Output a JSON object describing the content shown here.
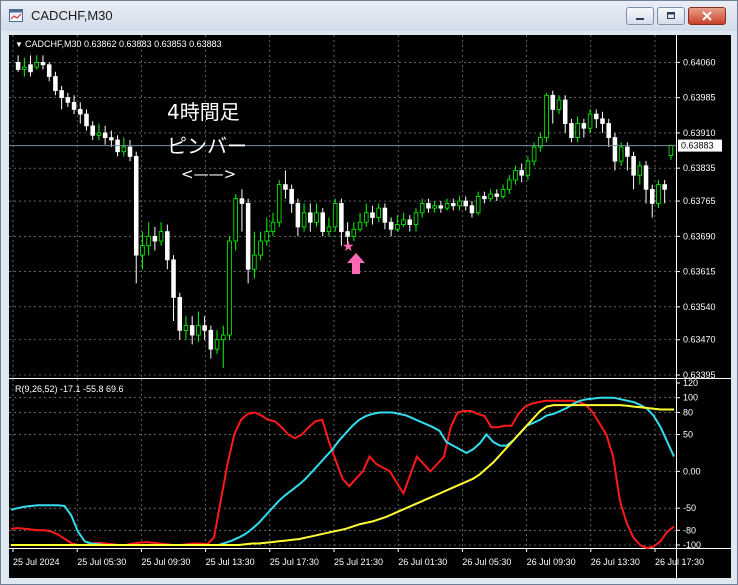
{
  "window": {
    "title": "CADCHF,M30",
    "buttons": [
      "minimize",
      "maximize",
      "close"
    ]
  },
  "price_pane": {
    "header_arrow": "▼",
    "header": "CADCHF,M30  0.63862 0.63883 0.63853 0.63883",
    "current_price": "0.63883",
    "y_ticks": [
      "0.64060",
      "0.63985",
      "0.63910",
      "0.63835",
      "0.63765",
      "0.63690",
      "0.63615",
      "0.63540",
      "0.63470",
      "0.63395"
    ],
    "annotation_line1": "4時間足",
    "annotation_line2": "ピンバー",
    "annotation_bracket": "<——>",
    "star_symbol": "★",
    "colors": {
      "bull": "#00ff00",
      "bear": "#ffffff",
      "marker": "#ff69b4",
      "bid_line": "#7a8fa8"
    }
  },
  "indicator_pane": {
    "header": "R(9,26,52) -17.1 -55.8 69.6",
    "y_ticks": [
      "120",
      "100",
      "80",
      "50",
      "0.00",
      "-50",
      "-80",
      "-100"
    ],
    "colors": {
      "fast": "#ff1a1a",
      "mid": "#33ddee",
      "slow": "#ffff33"
    }
  },
  "x_ticks": [
    "25 Jul 2024",
    "25 Jul 05:30",
    "25 Jul 09:30",
    "25 Jul 13:30",
    "25 Jul 17:30",
    "25 Jul 21:30",
    "26 Jul 01:30",
    "26 Jul 05:30",
    "26 Jul 09:30",
    "26 Jul 13:30",
    "26 Jul 17:30"
  ],
  "chart_data": [
    {
      "type": "candlestick",
      "title": "CADCHF,M30",
      "ylim": [
        0.63395,
        0.6408
      ],
      "candles": [
        [
          0.6406,
          0.64045,
          0.64075,
          0.6404
        ],
        [
          0.64045,
          0.6405,
          0.6407,
          0.6403
        ],
        [
          0.64055,
          0.6404,
          0.64075,
          0.6403
        ],
        [
          0.6405,
          0.6406,
          0.64075,
          0.64045
        ],
        [
          0.6406,
          0.64055,
          0.64075,
          0.64045
        ],
        [
          0.64055,
          0.6403,
          0.6406,
          0.6402
        ],
        [
          0.6403,
          0.64,
          0.6404,
          0.6399
        ],
        [
          0.64,
          0.63985,
          0.6401,
          0.6396
        ],
        [
          0.63985,
          0.63975,
          0.63995,
          0.63965
        ],
        [
          0.63975,
          0.6396,
          0.6399,
          0.6395
        ],
        [
          0.6396,
          0.6395,
          0.63975,
          0.6393
        ],
        [
          0.6395,
          0.63925,
          0.6396,
          0.63915
        ],
        [
          0.63925,
          0.63905,
          0.63935,
          0.63895
        ],
        [
          0.63905,
          0.6391,
          0.6393,
          0.63895
        ],
        [
          0.6391,
          0.639,
          0.63925,
          0.63885
        ],
        [
          0.639,
          0.63895,
          0.63915,
          0.6388
        ],
        [
          0.63895,
          0.6387,
          0.63905,
          0.6386
        ],
        [
          0.6387,
          0.6388,
          0.639,
          0.6386
        ],
        [
          0.6388,
          0.6386,
          0.63895,
          0.6385
        ],
        [
          0.6386,
          0.6365,
          0.6387,
          0.6359
        ],
        [
          0.6365,
          0.6367,
          0.637,
          0.6362
        ],
        [
          0.6367,
          0.6369,
          0.6372,
          0.6365
        ],
        [
          0.6369,
          0.6368,
          0.6371,
          0.6366
        ],
        [
          0.6368,
          0.637,
          0.6372,
          0.6367
        ],
        [
          0.637,
          0.6364,
          0.63715,
          0.6362
        ],
        [
          0.6364,
          0.6356,
          0.6365,
          0.6351
        ],
        [
          0.6356,
          0.6349,
          0.6357,
          0.6347
        ],
        [
          0.6349,
          0.635,
          0.6352,
          0.6347
        ],
        [
          0.635,
          0.6348,
          0.6352,
          0.6346
        ],
        [
          0.6348,
          0.635,
          0.6353,
          0.63465
        ],
        [
          0.635,
          0.6349,
          0.6352,
          0.6347
        ],
        [
          0.6349,
          0.6345,
          0.635,
          0.6343
        ],
        [
          0.6345,
          0.6347,
          0.6349,
          0.6344
        ],
        [
          0.6347,
          0.6348,
          0.635,
          0.6341
        ],
        [
          0.6348,
          0.6368,
          0.6369,
          0.6347
        ],
        [
          0.6368,
          0.6377,
          0.6378,
          0.6366
        ],
        [
          0.6377,
          0.6376,
          0.6379,
          0.637
        ],
        [
          0.6376,
          0.6362,
          0.6377,
          0.6359
        ],
        [
          0.6362,
          0.6365,
          0.637,
          0.636
        ],
        [
          0.6365,
          0.6368,
          0.637,
          0.6364
        ],
        [
          0.6368,
          0.637,
          0.6373,
          0.6367
        ],
        [
          0.637,
          0.6372,
          0.6374,
          0.6369
        ],
        [
          0.6372,
          0.638,
          0.6381,
          0.6371
        ],
        [
          0.638,
          0.6379,
          0.6383,
          0.6377
        ],
        [
          0.6379,
          0.6376,
          0.638,
          0.6374
        ],
        [
          0.6376,
          0.6371,
          0.6377,
          0.6369
        ],
        [
          0.6371,
          0.6374,
          0.6376,
          0.637
        ],
        [
          0.6374,
          0.6372,
          0.6376,
          0.637
        ],
        [
          0.6372,
          0.6374,
          0.6376,
          0.6371
        ],
        [
          0.6374,
          0.637,
          0.6375,
          0.6369
        ],
        [
          0.637,
          0.6371,
          0.6373,
          0.6369
        ],
        [
          0.6371,
          0.6376,
          0.6377,
          0.637
        ],
        [
          0.6376,
          0.637,
          0.6377,
          0.6367
        ],
        [
          0.637,
          0.6369,
          0.6372,
          0.6367
        ],
        [
          0.6369,
          0.63705,
          0.6372,
          0.6368
        ],
        [
          0.63705,
          0.6372,
          0.6374,
          0.637
        ],
        [
          0.6372,
          0.6374,
          0.6376,
          0.6371
        ],
        [
          0.6374,
          0.6373,
          0.63755,
          0.63715
        ],
        [
          0.6373,
          0.6375,
          0.6376,
          0.6372
        ],
        [
          0.6375,
          0.6372,
          0.6376,
          0.63705
        ],
        [
          0.6372,
          0.63705,
          0.6373,
          0.6369
        ],
        [
          0.63705,
          0.63715,
          0.63735,
          0.637
        ],
        [
          0.63715,
          0.63725,
          0.6374,
          0.6371
        ],
        [
          0.63725,
          0.63715,
          0.63735,
          0.637
        ],
        [
          0.63715,
          0.6374,
          0.6375,
          0.637
        ],
        [
          0.6374,
          0.6376,
          0.6377,
          0.6373
        ],
        [
          0.6376,
          0.6375,
          0.6377,
          0.6374
        ],
        [
          0.6375,
          0.63755,
          0.63765,
          0.6374
        ],
        [
          0.63755,
          0.6375,
          0.63765,
          0.6374
        ],
        [
          0.6375,
          0.6376,
          0.6377,
          0.63745
        ],
        [
          0.6376,
          0.63755,
          0.6377,
          0.63745
        ],
        [
          0.63755,
          0.63765,
          0.63775,
          0.63745
        ],
        [
          0.63765,
          0.63755,
          0.63775,
          0.63745
        ],
        [
          0.63755,
          0.6374,
          0.63765,
          0.6373
        ],
        [
          0.6374,
          0.63775,
          0.63785,
          0.63735
        ],
        [
          0.63775,
          0.6377,
          0.63785,
          0.6376
        ],
        [
          0.6377,
          0.6378,
          0.6379,
          0.63765
        ],
        [
          0.6378,
          0.63775,
          0.6379,
          0.63765
        ],
        [
          0.63775,
          0.6379,
          0.638,
          0.6377
        ],
        [
          0.6379,
          0.6381,
          0.6382,
          0.6378
        ],
        [
          0.6381,
          0.6383,
          0.6384,
          0.638
        ],
        [
          0.6383,
          0.6382,
          0.63845,
          0.63805
        ],
        [
          0.6382,
          0.6385,
          0.6386,
          0.6381
        ],
        [
          0.6385,
          0.6388,
          0.6389,
          0.6384
        ],
        [
          0.6388,
          0.639,
          0.6391,
          0.6387
        ],
        [
          0.639,
          0.6399,
          0.63995,
          0.6389
        ],
        [
          0.6399,
          0.6396,
          0.64,
          0.6393
        ],
        [
          0.6396,
          0.6398,
          0.6399,
          0.6395
        ],
        [
          0.6398,
          0.6393,
          0.6399,
          0.6391
        ],
        [
          0.6393,
          0.639,
          0.6394,
          0.6389
        ],
        [
          0.639,
          0.6393,
          0.63945,
          0.6389
        ],
        [
          0.6393,
          0.6392,
          0.6394,
          0.639
        ],
        [
          0.6392,
          0.6395,
          0.6396,
          0.6391
        ],
        [
          0.6395,
          0.6394,
          0.6396,
          0.6392
        ],
        [
          0.6394,
          0.6393,
          0.63955,
          0.6391
        ],
        [
          0.6393,
          0.639,
          0.6394,
          0.6388
        ],
        [
          0.639,
          0.6385,
          0.6391,
          0.6383
        ],
        [
          0.6385,
          0.6388,
          0.6389,
          0.6384
        ],
        [
          0.6388,
          0.6386,
          0.6389,
          0.6383
        ],
        [
          0.6386,
          0.6382,
          0.6387,
          0.6379
        ],
        [
          0.6382,
          0.6384,
          0.6385,
          0.638
        ],
        [
          0.6384,
          0.6379,
          0.6385,
          0.6376
        ],
        [
          0.6379,
          0.6376,
          0.638,
          0.6373
        ],
        [
          0.6376,
          0.638,
          0.6381,
          0.6375
        ],
        [
          0.638,
          0.6379,
          0.6381,
          0.6376
        ],
        [
          0.63862,
          0.63883,
          0.63885,
          0.63853
        ]
      ]
    },
    {
      "type": "line",
      "title": "R(9,26,52)",
      "ylim": [
        -100,
        120
      ],
      "series": [
        {
          "name": "-17.1",
          "values": [
            -78,
            -77,
            -78,
            -79,
            -80,
            -80,
            -82,
            -86,
            -92,
            -98,
            -100,
            -100,
            -98,
            -97,
            -98,
            -99,
            -100,
            -100,
            -98,
            -97,
            -96,
            -97,
            -98,
            -99,
            -100,
            -100,
            -99,
            -98,
            -98,
            -99,
            -90,
            -40,
            10,
            50,
            70,
            78,
            80,
            76,
            70,
            68,
            60,
            50,
            45,
            50,
            60,
            68,
            70,
            40,
            15,
            -10,
            -20,
            -10,
            0,
            20,
            10,
            5,
            0,
            -15,
            -30,
            -5,
            20,
            10,
            0,
            10,
            20,
            60,
            80,
            82,
            82,
            78,
            75,
            60,
            60,
            62,
            62,
            78,
            88,
            92,
            94,
            96,
            96,
            96,
            96,
            96,
            94,
            90,
            80,
            65,
            50,
            20,
            -40,
            -70,
            -90,
            -100,
            -104,
            -102,
            -95,
            -82,
            -75
          ]
        },
        {
          "name": "-55.8",
          "values": [
            -52,
            -50,
            -48,
            -47,
            -46,
            -46,
            -46,
            -46,
            -47,
            -60,
            -82,
            -95,
            -98,
            -99,
            -100,
            -100,
            -100,
            -100,
            -100,
            -100,
            -100,
            -100,
            -100,
            -100,
            -100,
            -100,
            -100,
            -100,
            -100,
            -100,
            -100,
            -100,
            -97,
            -94,
            -90,
            -85,
            -78,
            -70,
            -60,
            -50,
            -40,
            -32,
            -25,
            -18,
            -10,
            0,
            10,
            20,
            30,
            42,
            52,
            62,
            70,
            75,
            78,
            80,
            80,
            80,
            78,
            76,
            72,
            68,
            64,
            60,
            55,
            40,
            35,
            30,
            25,
            30,
            38,
            50,
            40,
            35,
            35,
            42,
            52,
            62,
            66,
            70,
            76,
            78,
            82,
            86,
            92,
            96,
            98,
            99,
            100,
            100,
            100,
            98,
            96,
            94,
            90,
            85,
            75,
            60,
            40,
            20
          ]
        },
        {
          "name": "69.6",
          "values": [
            -100,
            -100,
            -100,
            -100,
            -100,
            -100,
            -100,
            -100,
            -100,
            -100,
            -100,
            -100,
            -100,
            -100,
            -100,
            -100,
            -100,
            -100,
            -100,
            -100,
            -100,
            -100,
            -100,
            -100,
            -100,
            -100,
            -100,
            -100,
            -100,
            -100,
            -100,
            -100,
            -100,
            -100,
            -100,
            -99,
            -98,
            -98,
            -97,
            -96,
            -95,
            -94,
            -93,
            -92,
            -90,
            -88,
            -86,
            -84,
            -82,
            -80,
            -78,
            -75,
            -72,
            -70,
            -68,
            -65,
            -62,
            -58,
            -54,
            -50,
            -46,
            -42,
            -38,
            -34,
            -30,
            -26,
            -22,
            -18,
            -14,
            -10,
            -4,
            4,
            12,
            22,
            32,
            42,
            52,
            62,
            72,
            82,
            88,
            90,
            90,
            90,
            90,
            90,
            90,
            90,
            90,
            90,
            90,
            90,
            89,
            88,
            87,
            86,
            85,
            84,
            84,
            84
          ]
        }
      ]
    }
  ]
}
